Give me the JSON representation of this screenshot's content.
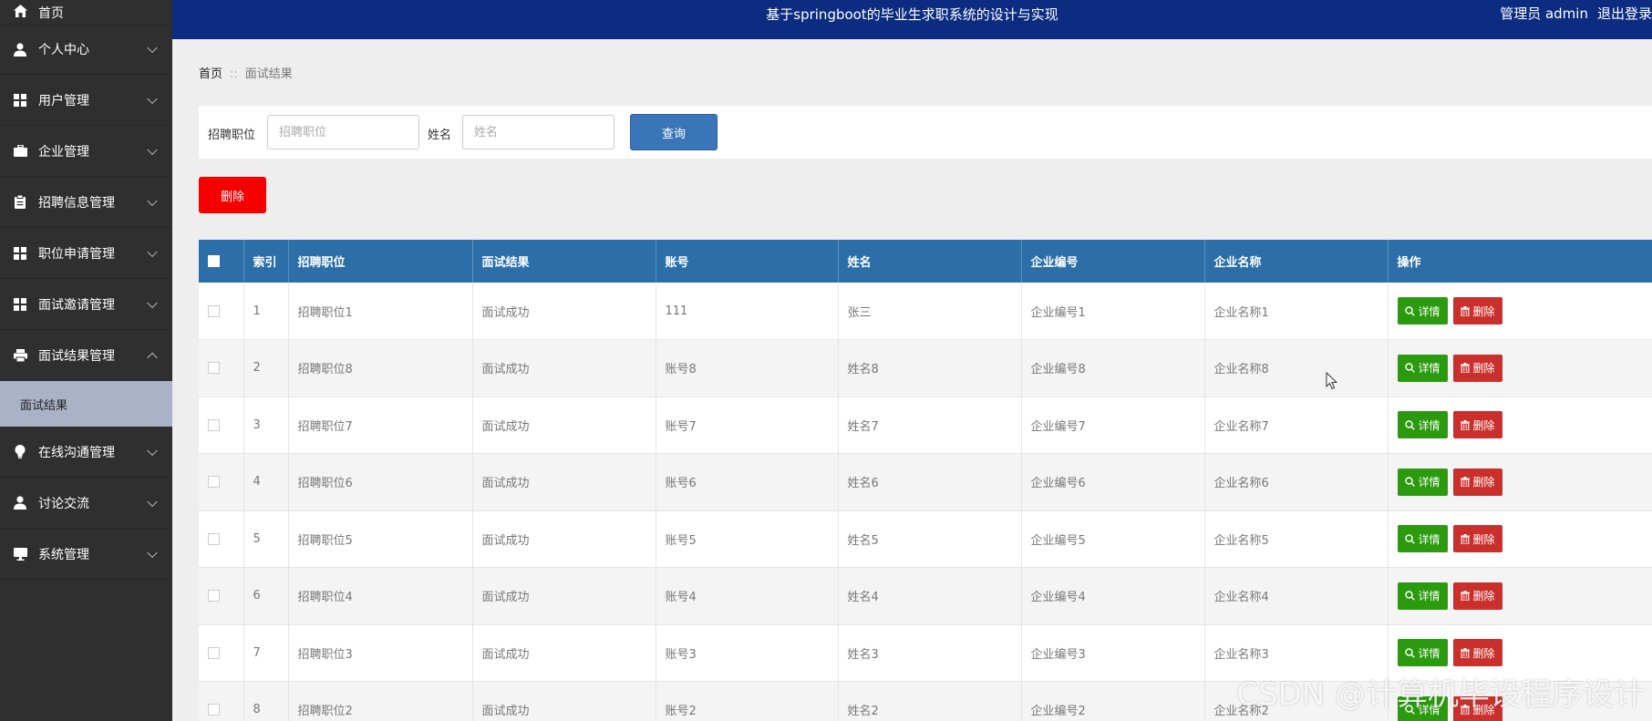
{
  "header": {
    "title": "基于springboot的毕业生求职系统的设计与实现",
    "user_role": "管理员 admin",
    "logout": "退出登录"
  },
  "sidebar": {
    "items": [
      {
        "label": "首页",
        "icon": "home-icon"
      },
      {
        "label": "个人中心",
        "icon": "user-icon"
      },
      {
        "label": "用户管理",
        "icon": "grid-icon"
      },
      {
        "label": "企业管理",
        "icon": "briefcase-icon"
      },
      {
        "label": "招聘信息管理",
        "icon": "clipboard-icon"
      },
      {
        "label": "职位申请管理",
        "icon": "grid-icon"
      },
      {
        "label": "面试邀请管理",
        "icon": "grid-icon"
      },
      {
        "label": "面试结果管理",
        "icon": "printer-icon"
      },
      {
        "label": "在线沟通管理",
        "icon": "lightbulb-icon"
      },
      {
        "label": "讨论交流",
        "icon": "user-icon"
      },
      {
        "label": "系统管理",
        "icon": "monitor-icon"
      }
    ],
    "active_sub": "面试结果"
  },
  "breadcrumb": {
    "home": "首页",
    "separator": "::",
    "current": "面试结果"
  },
  "search": {
    "position_label": "招聘职位",
    "position_placeholder": "招聘职位",
    "name_label": "姓名",
    "name_placeholder": "姓名",
    "query_button": "查询"
  },
  "toolbar": {
    "delete_label": "删除"
  },
  "table": {
    "headers": [
      "索引",
      "招聘职位",
      "面试结果",
      "账号",
      "姓名",
      "企业编号",
      "企业名称",
      "操作"
    ],
    "detail_label": "详情",
    "delete_label": "删除",
    "rows": [
      {
        "index": "1",
        "position": "招聘职位1",
        "result": "面试成功",
        "account": "111",
        "name": "张三",
        "company_no": "企业编号1",
        "company_name": "企业名称1"
      },
      {
        "index": "2",
        "position": "招聘职位8",
        "result": "面试成功",
        "account": "账号8",
        "name": "姓名8",
        "company_no": "企业编号8",
        "company_name": "企业名称8"
      },
      {
        "index": "3",
        "position": "招聘职位7",
        "result": "面试成功",
        "account": "账号7",
        "name": "姓名7",
        "company_no": "企业编号7",
        "company_name": "企业名称7"
      },
      {
        "index": "4",
        "position": "招聘职位6",
        "result": "面试成功",
        "account": "账号6",
        "name": "姓名6",
        "company_no": "企业编号6",
        "company_name": "企业名称6"
      },
      {
        "index": "5",
        "position": "招聘职位5",
        "result": "面试成功",
        "account": "账号5",
        "name": "姓名5",
        "company_no": "企业编号5",
        "company_name": "企业名称5"
      },
      {
        "index": "6",
        "position": "招聘职位4",
        "result": "面试成功",
        "account": "账号4",
        "name": "姓名4",
        "company_no": "企业编号4",
        "company_name": "企业名称4"
      },
      {
        "index": "7",
        "position": "招聘职位3",
        "result": "面试成功",
        "account": "账号3",
        "name": "姓名3",
        "company_no": "企业编号3",
        "company_name": "企业名称3"
      },
      {
        "index": "8",
        "position": "招聘职位2",
        "result": "面试成功",
        "account": "账号2",
        "name": "姓名2",
        "company_no": "企业编号2",
        "company_name": "企业名称2"
      }
    ]
  },
  "watermark": "CSDN @计算机毕设程序设计",
  "colors": {
    "header_bg": "#0b2c80",
    "sidebar_bg": "#2f2f2f",
    "table_header_bg": "#2b6ea8",
    "detail_button": "#2b9a0e",
    "delete_button": "#c9302c",
    "top_delete_button": "#f40000",
    "query_button": "#3a76b7"
  }
}
